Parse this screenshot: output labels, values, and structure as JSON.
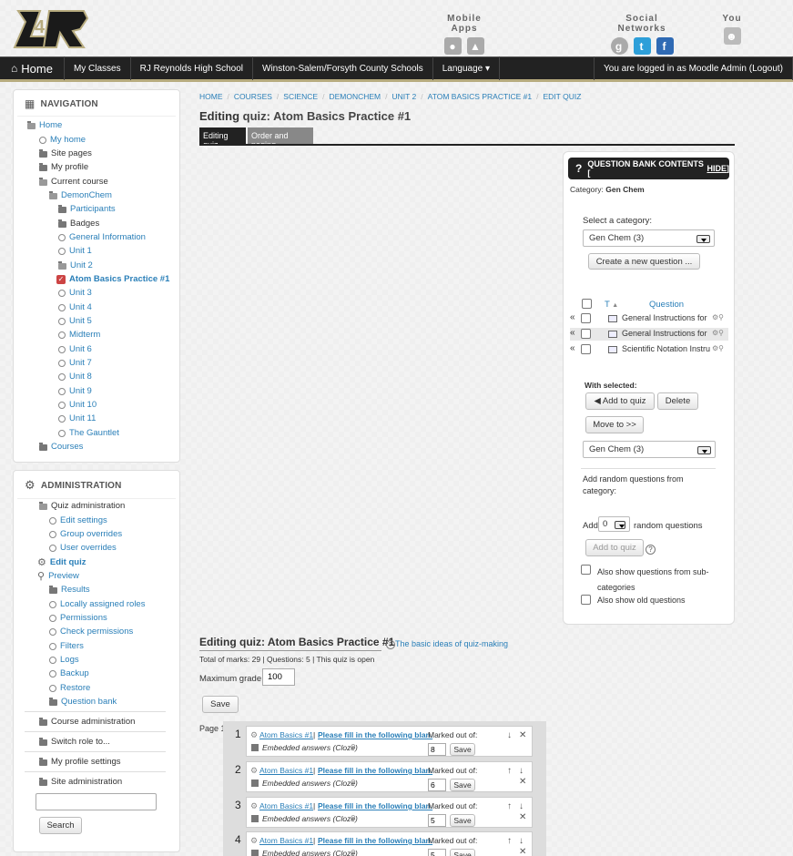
{
  "header": {
    "mobile_apps_title": "Mobile Apps",
    "social_title": "Social Networks",
    "you_title": "You"
  },
  "navbar": {
    "home": "Home",
    "items": [
      "My Classes",
      "RJ Reynolds High School",
      "Winston-Salem/Forsyth County Schools",
      "Language ▾"
    ],
    "user": "You are logged in as Moodle Admin (Logout)"
  },
  "navigation": {
    "title": "NAVIGATION",
    "items": [
      "Home",
      "My home",
      "Site pages",
      "My profile",
      "Current course",
      "DemonChem",
      "Participants",
      "Badges",
      "General Information",
      "Unit 1",
      "Unit 2",
      "Atom Basics Practice #1",
      "Unit 3",
      "Unit 4",
      "Unit 5",
      "Midterm",
      "Unit 6",
      "Unit 7",
      "Unit 8",
      "Unit 9",
      "Unit 10",
      "Unit 11",
      "The Gauntlet",
      "Courses"
    ]
  },
  "administration": {
    "title": "ADMINISTRATION",
    "items": [
      "Quiz administration",
      "Edit settings",
      "Group overrides",
      "User overrides",
      "Edit quiz",
      "Preview",
      "Results",
      "Locally assigned roles",
      "Permissions",
      "Check permissions",
      "Filters",
      "Logs",
      "Backup",
      "Restore",
      "Question bank",
      "Course administration",
      "Switch role to...",
      "My profile settings",
      "Site administration"
    ],
    "search_button": "Search"
  },
  "breadcrumb": [
    "Home",
    "Courses",
    "Science",
    "DemonChem",
    "Unit 2",
    "Atom Basics Practice #1",
    "Edit quiz"
  ],
  "page": {
    "editing_label": "Editing",
    "quiz_title": "quiz: Atom Basics Practice #1",
    "tabs": [
      "Editing quiz",
      "Order and paging"
    ]
  },
  "qbank": {
    "title": "QUESTION BANK CONTENTS [",
    "hide": "HIDE",
    "title_end": "]",
    "category_label": "Category:",
    "category_value": "Gen Chem",
    "select_category_label": "Select a category:",
    "category_select": "Gen Chem (3)",
    "create_button": "Create a new question ...",
    "col_type": "T",
    "col_question": "Question",
    "questions": [
      "General Instructions for",
      "General Instructions for",
      "Scientific Notation Instru"
    ],
    "with_selected": "With selected:",
    "add_to_quiz": "◀ Add to quiz",
    "delete": "Delete",
    "move_to": "Move to >>",
    "move_select": "Gen Chem (3)",
    "random_label": "Add random questions from category:",
    "add_label": "Add",
    "random_count": "0",
    "random_suffix": "random questions",
    "add_to_quiz_disabled": "Add to quiz",
    "show_subcat": "Also show questions from sub-categories",
    "show_old": "Also show old questions"
  },
  "quiz": {
    "heading": "Editing quiz: Atom Basics Practice #1",
    "help_link": "The basic ideas of quiz-making",
    "summary": "Total of marks: 29 | Questions: 5 | This quiz is open",
    "max_grade_label": "Maximum grade:",
    "max_grade": "100",
    "save": "Save",
    "page_label": "Page 1",
    "questions": [
      {
        "num": "1",
        "cat": "Atom Basics #1",
        "text": "Please fill in the following blan.",
        "type": "Embedded answers (Cloze)",
        "marks": "8"
      },
      {
        "num": "2",
        "cat": "Atom Basics #1",
        "text": "Please fill in the following blan.",
        "type": "Embedded answers (Cloze)",
        "marks": "6"
      },
      {
        "num": "3",
        "cat": "Atom Basics #1",
        "text": "Please fill in the following blan.",
        "type": "Embedded answers (Cloze)",
        "marks": "5"
      },
      {
        "num": "4",
        "cat": "Atom Basics #1",
        "text": "Please fill in the following blan.",
        "type": "Embedded answers (Cloze)",
        "marks": "5"
      }
    ],
    "marked_out_of": "Marked out of:",
    "save_small": "Save"
  }
}
